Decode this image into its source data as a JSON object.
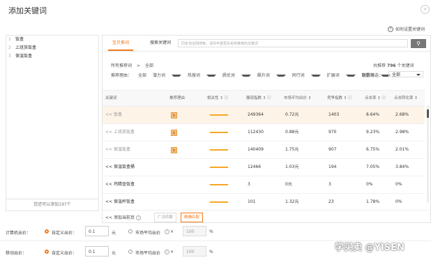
{
  "dialog": {
    "title": "添加关键词",
    "close_icon": "×",
    "help_link": "如何设置关键词"
  },
  "left": {
    "items": [
      {
        "num": "1",
        "label": "饭盒"
      },
      {
        "num": "2",
        "label": "上班族饭盒"
      },
      {
        "num": "3",
        "label": "保温饭盒"
      }
    ],
    "footer": "您还可以添加197个"
  },
  "tabs": {
    "recommend": "宝贝推词",
    "search": "搜索关键词"
  },
  "search": {
    "placeholder": "同步淘宝网搜索，请你丰富更多系统推荐的关键词",
    "button_icon": "search-icon"
  },
  "filters": {
    "line1_label": "所有推荐词",
    "line1_sep": ">",
    "line1_value": "全部",
    "reason_label": "推荐理由：",
    "reasons": [
      "全部",
      "潜力词",
      "热搜词",
      "质优词",
      "飙升词",
      "同行词",
      "扩展词",
      "联想词"
    ],
    "total_prefix": "共推荐",
    "total_count": "796",
    "total_suffix": "个关键词",
    "metric_label": "指数筛选：",
    "metric_value": "全部"
  },
  "columns": [
    "关键词",
    "推荐理由",
    "相关性",
    "展现指数",
    "市场平均出价",
    "竞争指数",
    "点击率",
    "点击转化率"
  ],
  "rows": [
    {
      "keyword": "<< 饭盒",
      "reason": "热",
      "impressions": "249364",
      "price": "0.72元",
      "competition": "1403",
      "ctr": "8.64%",
      "cvr": "2.68%"
    },
    {
      "keyword": "<< 上班族饭盒",
      "reason": "热",
      "impressions": "112430",
      "price": "0.88元",
      "competition": "970",
      "ctr": "9.23%",
      "cvr": "2.98%"
    },
    {
      "keyword": "<< 保温饭盒",
      "reason": "热",
      "impressions": "140409",
      "price": "1.75元",
      "competition": "907",
      "ctr": "6.75%",
      "cvr": "2.01%"
    },
    {
      "keyword": "<< 保温饭盒桶",
      "reason": "",
      "impressions": "12466",
      "price": "1.03元",
      "competition": "194",
      "ctr": "7.05%",
      "cvr": "3.84%"
    },
    {
      "keyword": "<< 鸡精壶饭盒",
      "reason": "",
      "impressions": "3",
      "price": "0元",
      "competition": "3",
      "ctr": "0%",
      "cvr": "0%"
    },
    {
      "keyword": "<< 保温杯饭盒",
      "reason": "",
      "impressions": "101",
      "price": "1.32元",
      "competition": "23",
      "ctr": "1.78%",
      "cvr": "0%"
    }
  ],
  "table_footer": {
    "add_page": "添加当前页",
    "broad": "广泛匹配",
    "exact": "精确匹配"
  },
  "bid_pc": {
    "label": "计算机出价：",
    "custom": "自定义出价：",
    "custom_value": "0.1",
    "unit": "元",
    "market": "市场平均出价",
    "pct_value": "100",
    "pct_unit": "%"
  },
  "bid_mobile": {
    "label": "移动出价：",
    "custom": "自定义出价：",
    "custom_value": "0.1",
    "unit": "元",
    "market": "市场平均出价",
    "pct_value": "100",
    "pct_unit": "%"
  },
  "watermark": "学买卖 @YISEN",
  "colors": {
    "accent": "#f37b1d",
    "highlight_row": "#fdf4e7",
    "bar": "#f5a623"
  }
}
